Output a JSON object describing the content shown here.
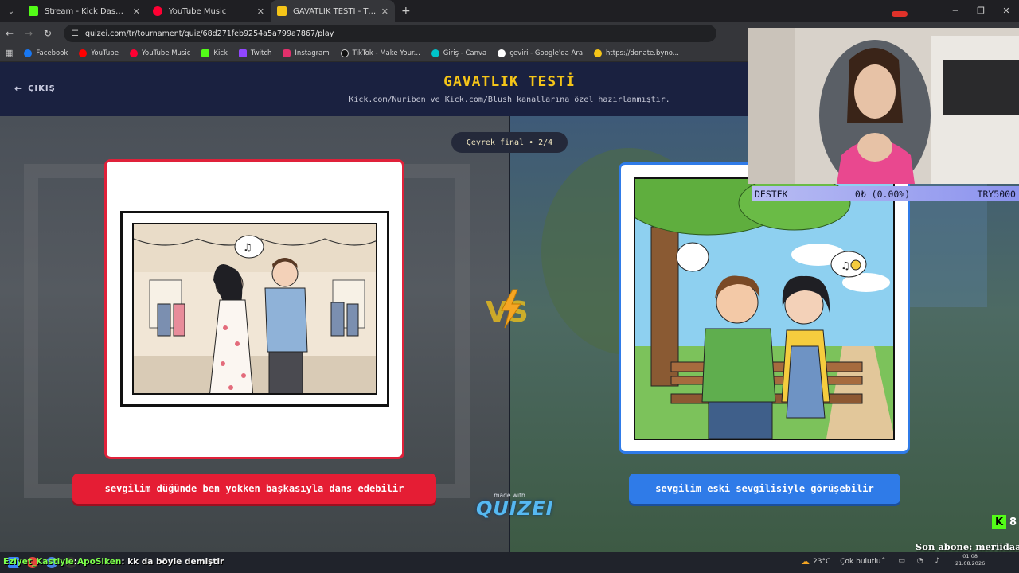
{
  "browser": {
    "tabs": [
      {
        "label": "Stream - Kick Dashboard",
        "icon": "kick-icon",
        "color": "#53fc18"
      },
      {
        "label": "YouTube Music",
        "icon": "youtube-music-icon",
        "color": "#ff0033"
      },
      {
        "label": "GAVATLIK TESTİ - Tier List, Kör",
        "icon": "quizei-icon",
        "color": "#f5c518"
      }
    ],
    "new_tab": "+",
    "url": "quizei.com/tr/tournament/quiz/68d271feb9254a5a799a7867/play",
    "bookmarks": [
      {
        "label": "Facebook",
        "icon": "facebook-icon",
        "color": "#1877f2"
      },
      {
        "label": "YouTube",
        "icon": "youtube-icon",
        "color": "#ff0000"
      },
      {
        "label": "YouTube Music",
        "icon": "youtube-music-icon",
        "color": "#ff0033"
      },
      {
        "label": "Kick",
        "icon": "kick-icon",
        "color": "#53fc18"
      },
      {
        "label": "Twitch",
        "icon": "twitch-icon",
        "color": "#9146ff"
      },
      {
        "label": "Instagram",
        "icon": "instagram-icon",
        "color": "#e1306c"
      },
      {
        "label": "TikTok - Make Your...",
        "icon": "tiktok-icon",
        "color": "#111111"
      },
      {
        "label": "Giriş - Canva",
        "icon": "canva-icon",
        "color": "#00c4cc"
      },
      {
        "label": "çeviri - Google'da Ara",
        "icon": "google-icon",
        "color": "#ffffff"
      },
      {
        "label": "https://donate.byno...",
        "icon": "donate-icon",
        "color": "#f5c518"
      }
    ]
  },
  "quiz": {
    "exit_label": "ÇIKIŞ",
    "title": "GAVATLIK TESTİ",
    "subtitle": "Kick.com/Nuriben ve Kick.com/Blush kanallarına özel hazırlanmıştır.",
    "round": "Çeyrek final • 2/4",
    "vs_label": "VS",
    "options": {
      "left": "sevgilim düğünde ben yokken başkasıyla dans edebilir",
      "right": "sevgilim eski sevgilisiyle görüşebilir"
    },
    "made_with": "made with",
    "brand": "QUIZEI"
  },
  "stream": {
    "donation": {
      "label": "DESTEK",
      "amount": "0₺ (0.00%)",
      "goal": "TRY5000"
    },
    "viewers": "8",
    "last_sub": "Son abone: meriidaa",
    "chat": {
      "user": "Eziyet_Kastiyle",
      "separator": ":",
      "user2": "ApoSiken",
      "message": ": kk da böyle demiştir"
    }
  },
  "taskbar": {
    "temperature": "23°C",
    "weather": "Çok bulutlu",
    "time": "01:08",
    "date": "21.08.2026"
  },
  "colors": {
    "accent_red": "#e51d34",
    "accent_blue": "#2f7be8",
    "title_yellow": "#f5c518"
  }
}
